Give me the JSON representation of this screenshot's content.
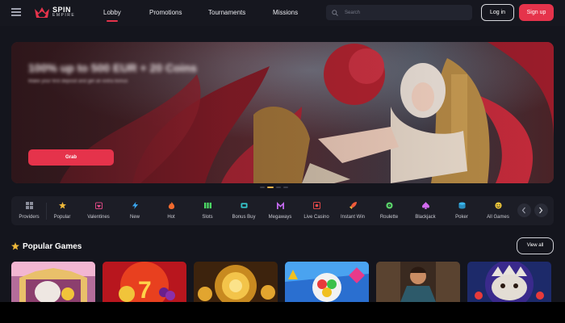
{
  "header": {
    "logo": {
      "line1": "SPIN",
      "line2": "EMPIRE"
    },
    "nav": [
      {
        "label": "Lobby",
        "active": true
      },
      {
        "label": "Promotions",
        "active": false
      },
      {
        "label": "Tournaments",
        "active": false
      },
      {
        "label": "Missions",
        "active": false
      }
    ],
    "search_placeholder": "Search",
    "login_label": "Log in",
    "signup_label": "Sign up"
  },
  "banner": {
    "title": "100% up to 500 EUR + 20 Coins",
    "subtitle": "Make your first deposit and get an extra bonus",
    "cta_label": "Grab",
    "slides": 4,
    "active_slide": 1
  },
  "categories": [
    {
      "label": "Providers",
      "icon": "grid-icon",
      "color": "#8b8e9b"
    },
    {
      "label": "Popular",
      "icon": "star-icon",
      "color": "#f0b93a"
    },
    {
      "label": "Valentines",
      "icon": "heart-calendar-icon",
      "color": "#e94b8a"
    },
    {
      "label": "New",
      "icon": "lightning-icon",
      "color": "#3aa6f0"
    },
    {
      "label": "Hot",
      "icon": "flame-icon",
      "color": "#f26a2e"
    },
    {
      "label": "Slots",
      "icon": "slots-icon",
      "color": "#4cd964"
    },
    {
      "label": "Bonus Buy",
      "icon": "cart-icon",
      "color": "#35c3c8"
    },
    {
      "label": "Megaways",
      "icon": "megaways-icon",
      "color": "#c46af0"
    },
    {
      "label": "Live Casino",
      "icon": "live-icon",
      "color": "#ef4b4b"
    },
    {
      "label": "Instant Win",
      "icon": "rocket-icon",
      "color": "#ee5a3a"
    },
    {
      "label": "Roulette",
      "icon": "roulette-icon",
      "color": "#5ad46a"
    },
    {
      "label": "Blackjack",
      "icon": "spade-icon",
      "color": "#d26af0"
    },
    {
      "label": "Poker",
      "icon": "chips-icon",
      "color": "#3ab8f0"
    },
    {
      "label": "All Games",
      "icon": "smiley-icon",
      "color": "#f0c93a"
    }
  ],
  "popular": {
    "title": "Popular Games",
    "view_all_label": "View all"
  },
  "colors": {
    "accent": "#e5334b",
    "background": "#14151d",
    "panel": "#1c1d26"
  }
}
